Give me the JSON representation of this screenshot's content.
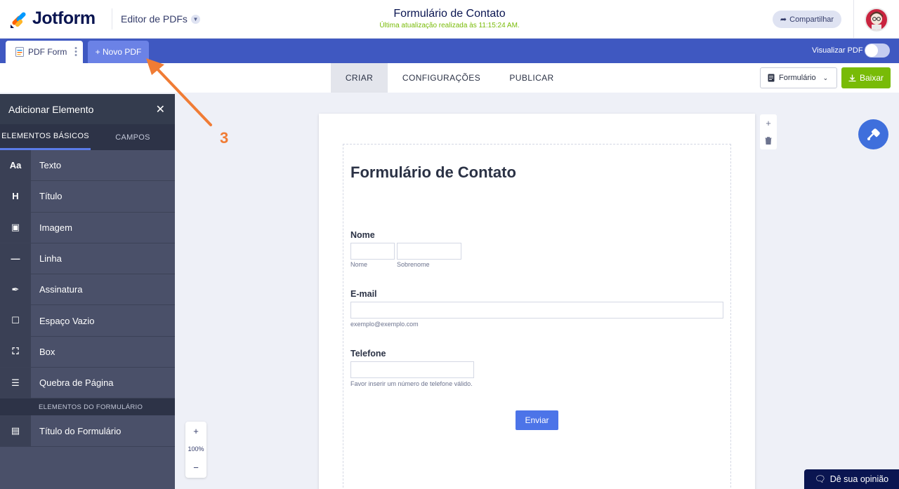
{
  "header": {
    "logo_text": "Jotform",
    "product_name": "Editor de PDFs",
    "doc_title": "Formulário de Contato",
    "doc_subtitle": "Última atualização realizada às 11:15:24 AM.",
    "share_label": "Compartilhar"
  },
  "tabs": {
    "active_tab_label": "PDF Form",
    "new_pdf_label": "+ Novo PDF",
    "preview_label": "Visualizar PDF"
  },
  "nav": {
    "items": [
      "CRIAR",
      "CONFIGURAÇÕES",
      "PUBLICAR"
    ],
    "active": "CRIAR",
    "form_select": "Formulário",
    "download_label": "Baixar"
  },
  "panel": {
    "title": "Adicionar Elemento",
    "tabs": [
      "ELEMENTOS BÁSICOS",
      "CAMPOS"
    ],
    "basic_elements": [
      {
        "icon": "text-icon",
        "glyph": "Aa",
        "label": "Texto"
      },
      {
        "icon": "heading-icon",
        "glyph": "H",
        "label": "Título"
      },
      {
        "icon": "image-icon",
        "glyph": "▣",
        "label": "Imagem"
      },
      {
        "icon": "line-icon",
        "glyph": "—",
        "label": "Linha"
      },
      {
        "icon": "signature-icon",
        "glyph": "✒",
        "label": "Assinatura"
      },
      {
        "icon": "empty-space-icon",
        "glyph": "☐",
        "label": "Espaço Vazio"
      },
      {
        "icon": "box-icon",
        "glyph": "⛶",
        "label": "Box"
      },
      {
        "icon": "page-break-icon",
        "glyph": "☰",
        "label": "Quebra de Página"
      }
    ],
    "form_section_label": "ELEMENTOS DO FORMULÁRIO",
    "form_elements": [
      {
        "icon": "form-title-icon",
        "glyph": "▤",
        "label": "Título do Formulário"
      }
    ]
  },
  "zoom": {
    "plus": "+",
    "level": "100%",
    "minus": "−"
  },
  "form": {
    "title": "Formulário de Contato",
    "name_label": "Nome",
    "first_hint": "Nome",
    "last_hint": "Sobrenome",
    "email_label": "E-mail",
    "email_hint": "exemplo@exemplo.com",
    "phone_label": "Telefone",
    "phone_hint": "Favor inserir um número de telefone válido.",
    "submit_label": "Enviar"
  },
  "annotation": {
    "step_number": "3",
    "color": "#f07c35"
  },
  "feedback_label": "Dê sua opinião",
  "colors": {
    "brand_navy": "#0a1551",
    "tab_bar": "#3f58c1",
    "download_green": "#78bb07",
    "submit_blue": "#4c74e8"
  }
}
